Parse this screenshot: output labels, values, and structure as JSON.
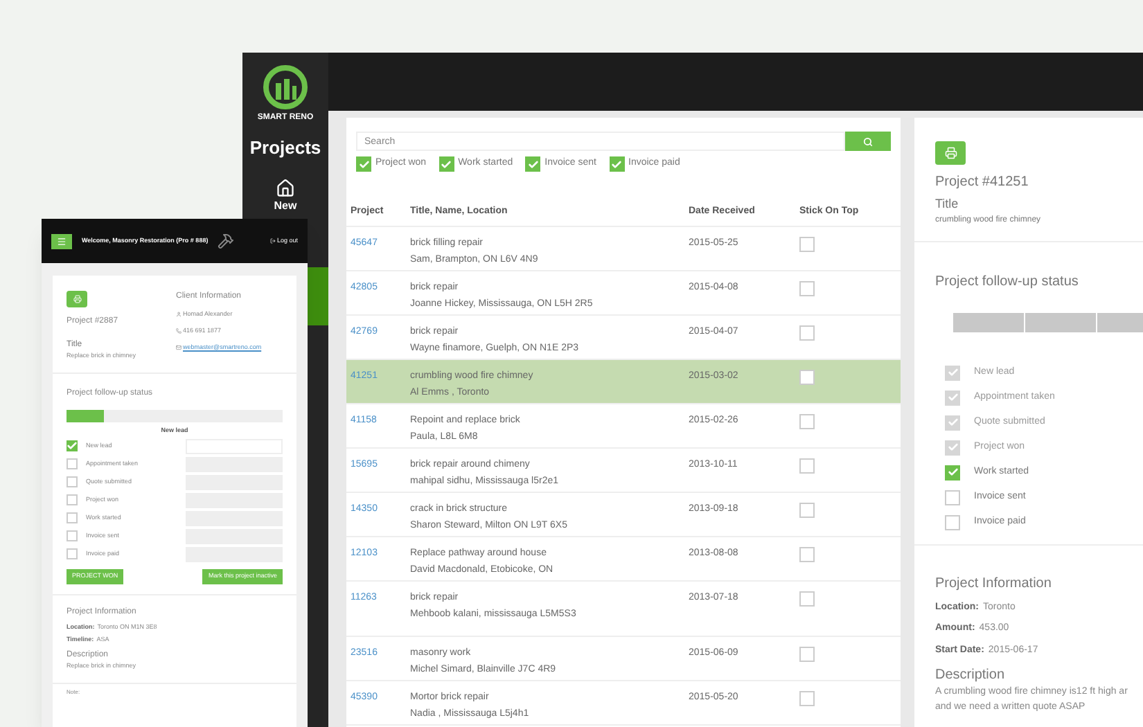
{
  "desktop": {
    "logo_text": "SMART RENO",
    "sidebar_title": "Projects",
    "nav": [
      {
        "label": "New",
        "selected": false
      }
    ],
    "search": {
      "placeholder": "Search"
    },
    "filters": [
      {
        "label": "Project won",
        "checked": true
      },
      {
        "label": "Work started",
        "checked": true
      },
      {
        "label": "Invoice sent",
        "checked": true
      },
      {
        "label": "Invoice paid",
        "checked": true
      }
    ],
    "table": {
      "columns": [
        "Project",
        "Title, Name, Location",
        "Date Received",
        "Stick On Top"
      ],
      "rows": [
        {
          "project": "45647",
          "title": "brick filling repair",
          "location": "Sam, Brampton, ON L6V 4N9",
          "date": "2015-05-25",
          "stick": false,
          "selected": false
        },
        {
          "project": "42805",
          "title": "brick repair",
          "location": "Joanne Hickey, Mississauga, ON L5H 2R5",
          "date": "2015-04-08",
          "stick": false,
          "selected": false
        },
        {
          "project": "42769",
          "title": "brick repair",
          "location": "Wayne finamore, Guelph, ON N1E 2P3",
          "date": "2015-04-07",
          "stick": false,
          "selected": false
        },
        {
          "project": "41251",
          "title": "crumbling wood fire chimney",
          "location": "Al Emms , Toronto",
          "date": "2015-03-02",
          "stick": false,
          "selected": true
        },
        {
          "project": "41158",
          "title": "Repoint and replace brick",
          "location": "Paula, L8L 6M8",
          "date": "2015-02-26",
          "stick": false,
          "selected": false
        },
        {
          "project": "15695",
          "title": "brick repair around chimeny",
          "location": "mahipal sidhu, Mississauga l5r2e1",
          "date": "2013-10-11",
          "stick": false,
          "selected": false
        },
        {
          "project": "14350",
          "title": "crack in brick structure",
          "location": "Sharon Steward, Milton ON L9T 6X5",
          "date": "2013-09-18",
          "stick": false,
          "selected": false
        },
        {
          "project": "12103",
          "title": "Replace pathway around house",
          "location": "David Macdonald, Etobicoke, ON",
          "date": "2013-08-08",
          "stick": false,
          "selected": false
        },
        {
          "project": "11263",
          "title": "brick repair",
          "location": "Mehboob kalani, mississauga L5M5S3",
          "date": "2013-07-18",
          "stick": false,
          "selected": false
        },
        {
          "project": "23516",
          "title": "masonry work",
          "location": "Michel Simard, Blainville J7C 4R9",
          "date": "2015-06-09",
          "stick": false,
          "selected": false
        },
        {
          "project": "45390",
          "title": "Mortor brick repair",
          "location": "Nadia , Mississauga L5j4h1",
          "date": "2015-05-20",
          "stick": false,
          "selected": false
        }
      ]
    },
    "detail": {
      "project": "Project #41251",
      "title_label": "Title",
      "title": "crumbling wood fire chimney",
      "status_heading": "Project follow-up status",
      "statuses": [
        {
          "label": "New lead",
          "checked": true,
          "disabled": true
        },
        {
          "label": "Appointment taken",
          "checked": true,
          "disabled": true
        },
        {
          "label": "Quote submitted",
          "checked": true,
          "disabled": true
        },
        {
          "label": "Project won",
          "checked": true,
          "disabled": true
        },
        {
          "label": "Work started",
          "checked": true,
          "disabled": false
        },
        {
          "label": "Invoice sent",
          "checked": false,
          "disabled": false
        },
        {
          "label": "Invoice paid",
          "checked": false,
          "disabled": false
        }
      ],
      "info_heading": "Project Information",
      "fields": [
        {
          "label": "Location:",
          "value": "Toronto"
        },
        {
          "label": "Amount:",
          "value": "453.00"
        },
        {
          "label": "Start Date:",
          "value": "2015-06-17"
        }
      ],
      "description_heading": "Description",
      "description": "A crumbling wood fire chimney is12 ft high ar",
      "description_2": "and we need a written quote ASAP"
    }
  },
  "mobile": {
    "welcome": "Welcome, Masonry Restoration (Pro # 888)",
    "logout": "Log out",
    "project": "Project #2887",
    "title_label": "Title",
    "title": "Replace brick in chimney",
    "client_heading": "Client Information",
    "client_name": "Homad Alexander",
    "client_phone": "416 691 1877",
    "client_email": "webmaster@smartreno.com",
    "status_heading": "Project follow-up status",
    "progress": {
      "level": 0.17
    },
    "current_status": "New lead",
    "statuses": [
      {
        "label": "New lead",
        "checked": true
      },
      {
        "label": "Appointment taken",
        "checked": false
      },
      {
        "label": "Quote submitted",
        "checked": false
      },
      {
        "label": "Project won",
        "checked": false
      },
      {
        "label": "Work started",
        "checked": false
      },
      {
        "label": "Invoice sent",
        "checked": false
      },
      {
        "label": "Invoice paid",
        "checked": false
      }
    ],
    "buttons": [
      "PROJECT WON",
      "Mark this project inactive"
    ],
    "info_heading": "Project Information",
    "fields": [
      {
        "label": "Location:",
        "value": "Toronto ON M1N 3E8"
      },
      {
        "label": "Timeline:",
        "value": "ASA"
      }
    ],
    "description_heading": "Description",
    "description": "Replace brick in chimney",
    "note_label": "Note:"
  }
}
